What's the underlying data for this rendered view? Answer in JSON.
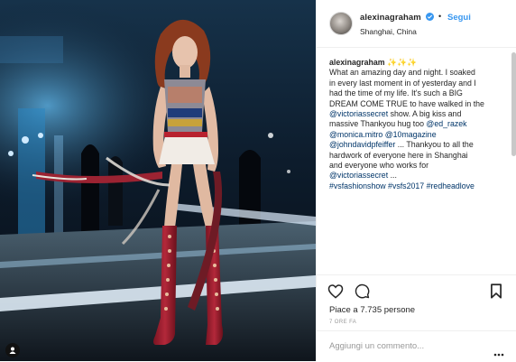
{
  "post": {
    "username": "alexinagraham",
    "dot": "•",
    "follow_label": "Segui",
    "location": "Shanghai, China"
  },
  "caption": {
    "username": "alexinagraham",
    "emoji": "✨✨✨",
    "lines": [
      "What an amazing day and night. I soaked",
      "in every last moment in of yesterday and I",
      "had the time of my life. It's such a BIG",
      "DREAM COME TRUE to have walked in the"
    ],
    "line5_link": "@victoriassecret",
    "line5_text": " show. A big kiss and",
    "line6_text": "massive Thankyou hug too ",
    "line6_link": "@ed_razek",
    "line7_link1": "@monica.mitro",
    "line7_link2": "@10magazine",
    "line8_link": "@johndavidpfeiffer",
    "line8_text": " ... Thankyou to all the",
    "line9_text": "hardwork of everyone here in Shanghai",
    "line10_text": "and everyone who works for",
    "line11_link": "@victoriassecret",
    "line11_text": " ...",
    "line12_link1": "#vsfashionshow",
    "line12_link2": "#vsfs2017",
    "line12_link3": "#redheadlove"
  },
  "engagement": {
    "likes_text": "Piace a 7.735 persone",
    "time_text": "7 ORE FA"
  },
  "comment": {
    "placeholder": "Aggiungi un commento..."
  },
  "icons": {
    "like": "heart-icon",
    "comment": "comment-icon",
    "save": "bookmark-icon",
    "more": "more-options-icon",
    "tag": "user-tag-icon",
    "verified": "verified-badge-icon"
  },
  "colors": {
    "link": "#003569",
    "follow": "#3897f0",
    "muted": "#999999",
    "text": "#262626"
  }
}
